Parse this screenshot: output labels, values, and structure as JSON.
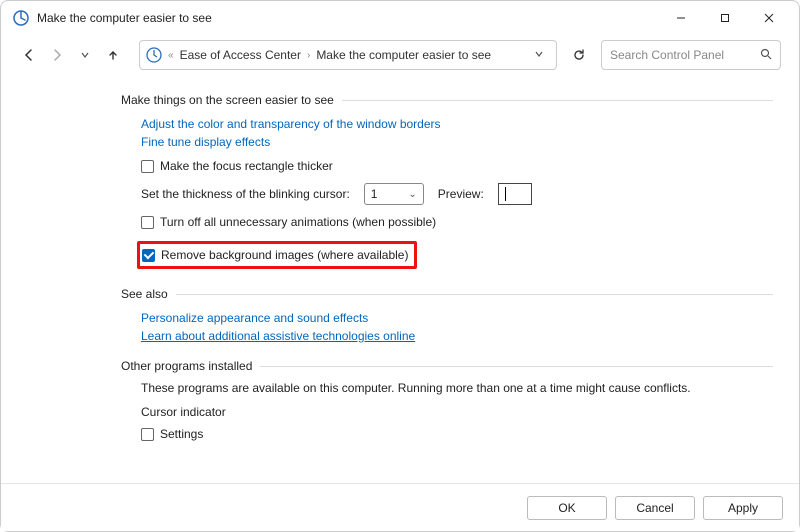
{
  "window": {
    "title": "Make the computer easier to see"
  },
  "breadcrumb": {
    "root_chevrons": "«",
    "item1": "Ease of Access Center",
    "item2": "Make the computer easier to see"
  },
  "search": {
    "placeholder": "Search Control Panel"
  },
  "section_main": {
    "heading": "Make things on the screen easier to see"
  },
  "links": {
    "adjust_borders": "Adjust the color and transparency of the window borders",
    "fine_tune": "Fine tune display effects",
    "personalize": "Personalize appearance and sound effects",
    "assistive": "Learn about additional assistive technologies online"
  },
  "checkboxes": {
    "focus_rect": {
      "label": "Make the focus rectangle thicker",
      "checked": false
    },
    "turn_off_anim": {
      "label": "Turn off all unnecessary animations (when possible)",
      "checked": false
    },
    "remove_bg": {
      "label": "Remove background images (where available)",
      "checked": true
    },
    "cursor_settings": {
      "label": "Settings",
      "checked": false
    }
  },
  "cursor": {
    "label": "Set the thickness of the blinking cursor:",
    "value": "1",
    "preview_label": "Preview:"
  },
  "section_see_also": {
    "heading": "See also"
  },
  "section_other": {
    "heading": "Other programs installed",
    "desc": "These programs are available on this computer. Running more than one at a time might cause conflicts.",
    "cursor_indicator": "Cursor indicator"
  },
  "footer": {
    "ok": "OK",
    "cancel": "Cancel",
    "apply": "Apply"
  }
}
